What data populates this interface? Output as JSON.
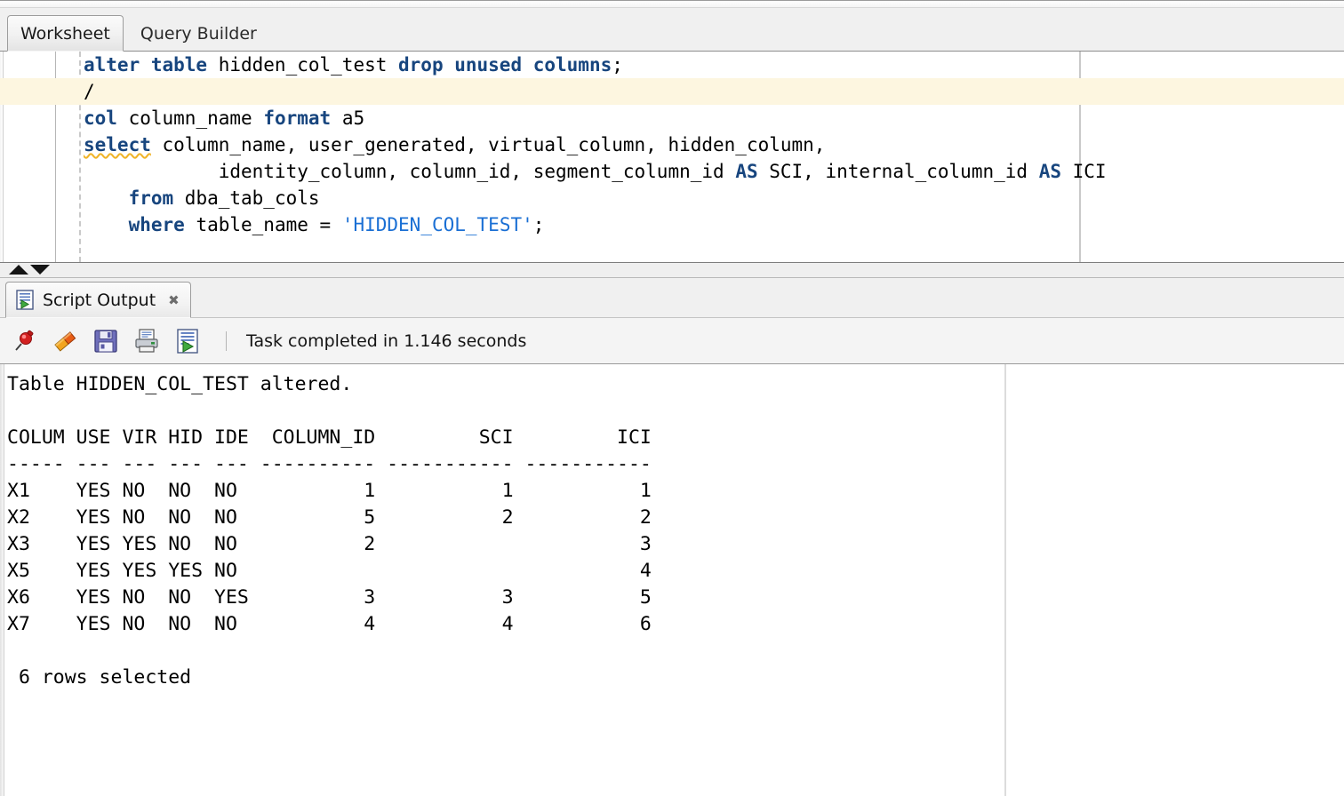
{
  "worksheet_tabs": [
    {
      "label": "Worksheet",
      "active": true
    },
    {
      "label": "Query Builder",
      "active": false
    }
  ],
  "editor": {
    "lines": [
      {
        "highlighted": false,
        "fold": false,
        "segments": [
          {
            "text": "alter table",
            "style": "kw"
          },
          {
            "text": " hidden_col_test ",
            "style": "plain"
          },
          {
            "text": "drop unused columns",
            "style": "kw"
          },
          {
            "text": ";",
            "style": "plain"
          }
        ]
      },
      {
        "highlighted": true,
        "fold": false,
        "segments": [
          {
            "text": "/",
            "style": "plain"
          }
        ]
      },
      {
        "highlighted": false,
        "fold": false,
        "segments": [
          {
            "text": "col",
            "style": "kw"
          },
          {
            "text": " column_name ",
            "style": "plain"
          },
          {
            "text": "format",
            "style": "kw"
          },
          {
            "text": " a5",
            "style": "plain"
          }
        ]
      },
      {
        "highlighted": false,
        "fold": true,
        "segments": [
          {
            "text": "select",
            "style": "kw-squiggle"
          },
          {
            "text": " column_name, user_generated, virtual_column, hidden_column,",
            "style": "plain"
          }
        ]
      },
      {
        "highlighted": false,
        "fold": false,
        "segments": [
          {
            "text": "            identity_column, column_id, segment_column_id ",
            "style": "plain"
          },
          {
            "text": "AS",
            "style": "kw"
          },
          {
            "text": " SCI, internal_column_id ",
            "style": "plain"
          },
          {
            "text": "AS",
            "style": "kw"
          },
          {
            "text": " ICI",
            "style": "plain"
          }
        ]
      },
      {
        "highlighted": false,
        "fold": false,
        "segments": [
          {
            "text": "    ",
            "style": "plain"
          },
          {
            "text": "from",
            "style": "kw"
          },
          {
            "text": " dba_tab_cols",
            "style": "plain"
          }
        ]
      },
      {
        "highlighted": false,
        "fold": false,
        "segments": [
          {
            "text": "    ",
            "style": "plain"
          },
          {
            "text": "where",
            "style": "kw"
          },
          {
            "text": " table_name = ",
            "style": "plain"
          },
          {
            "text": "'HIDDEN_COL_TEST'",
            "style": "str"
          },
          {
            "text": ";",
            "style": "plain"
          }
        ]
      }
    ]
  },
  "output_panel": {
    "tab_label": "Script Output",
    "close_label": "✖",
    "toolbar": {
      "icons": [
        {
          "name": "pin-icon",
          "title": "Pin"
        },
        {
          "name": "eraser-icon",
          "title": "Clear"
        },
        {
          "name": "save-icon",
          "title": "Save"
        },
        {
          "name": "print-icon",
          "title": "Print"
        },
        {
          "name": "run-script-icon",
          "title": "Run Script"
        }
      ],
      "status": "Task completed in 1.146 seconds"
    },
    "text": "Table HIDDEN_COL_TEST altered.\n\nCOLUM USE VIR HID IDE  COLUMN_ID         SCI         ICI\n----- --- --- --- --- ---------- ----------- -----------\nX1    YES NO  NO  NO           1           1           1\nX2    YES NO  NO  NO           5           2           2\nX3    YES YES NO  NO           2                       3\nX5    YES YES YES NO                                   4\nX6    YES NO  NO  YES          3           3           5\nX7    YES NO  NO  NO           4           4           6\n\n 6 rows selected",
    "result_table": {
      "columns": [
        "COLUM",
        "USE",
        "VIR",
        "HID",
        "IDE",
        "COLUMN_ID",
        "SCI",
        "ICI"
      ],
      "rows": [
        [
          "X1",
          "YES",
          "NO",
          "NO",
          "NO",
          "1",
          "1",
          "1"
        ],
        [
          "X2",
          "YES",
          "NO",
          "NO",
          "NO",
          "5",
          "2",
          "2"
        ],
        [
          "X3",
          "YES",
          "YES",
          "NO",
          "NO",
          "2",
          "",
          "3"
        ],
        [
          "X5",
          "YES",
          "YES",
          "YES",
          "NO",
          "",
          "",
          "4"
        ],
        [
          "X6",
          "YES",
          "NO",
          "NO",
          "YES",
          "3",
          "3",
          "5"
        ],
        [
          "X7",
          "YES",
          "NO",
          "NO",
          "NO",
          "4",
          "4",
          "6"
        ]
      ],
      "header_message": "Table HIDDEN_COL_TEST altered.",
      "footer_message": " 6 rows selected"
    }
  },
  "colors": {
    "keyword": "#17457e",
    "string": "#1a6fd4",
    "current_line": "#fdf6e0",
    "squiggle": "#f0b429"
  }
}
